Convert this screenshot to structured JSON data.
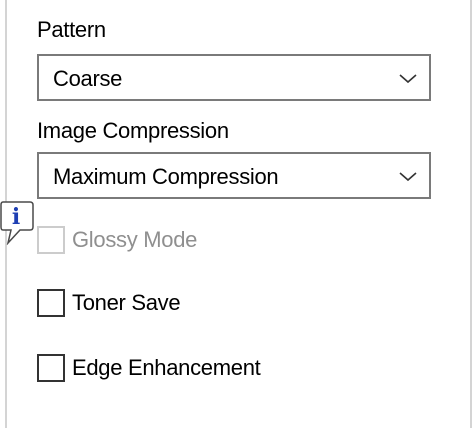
{
  "pattern": {
    "label": "Pattern",
    "selected": "Coarse"
  },
  "image_compression": {
    "label": "Image Compression",
    "selected": "Maximum Compression"
  },
  "glossy_mode": {
    "label": "Glossy Mode",
    "checked": false,
    "enabled": false
  },
  "toner_save": {
    "label": "Toner Save",
    "checked": false
  },
  "edge_enhancement": {
    "label": "Edge Enhancement",
    "checked": false
  },
  "icons": {
    "info": "info-icon",
    "dropdown": "chevron-down-icon"
  },
  "colors": {
    "info_blue": "#1e3fb3",
    "border": "#7a7a7a",
    "disabled_text": "#8f8f8f"
  }
}
